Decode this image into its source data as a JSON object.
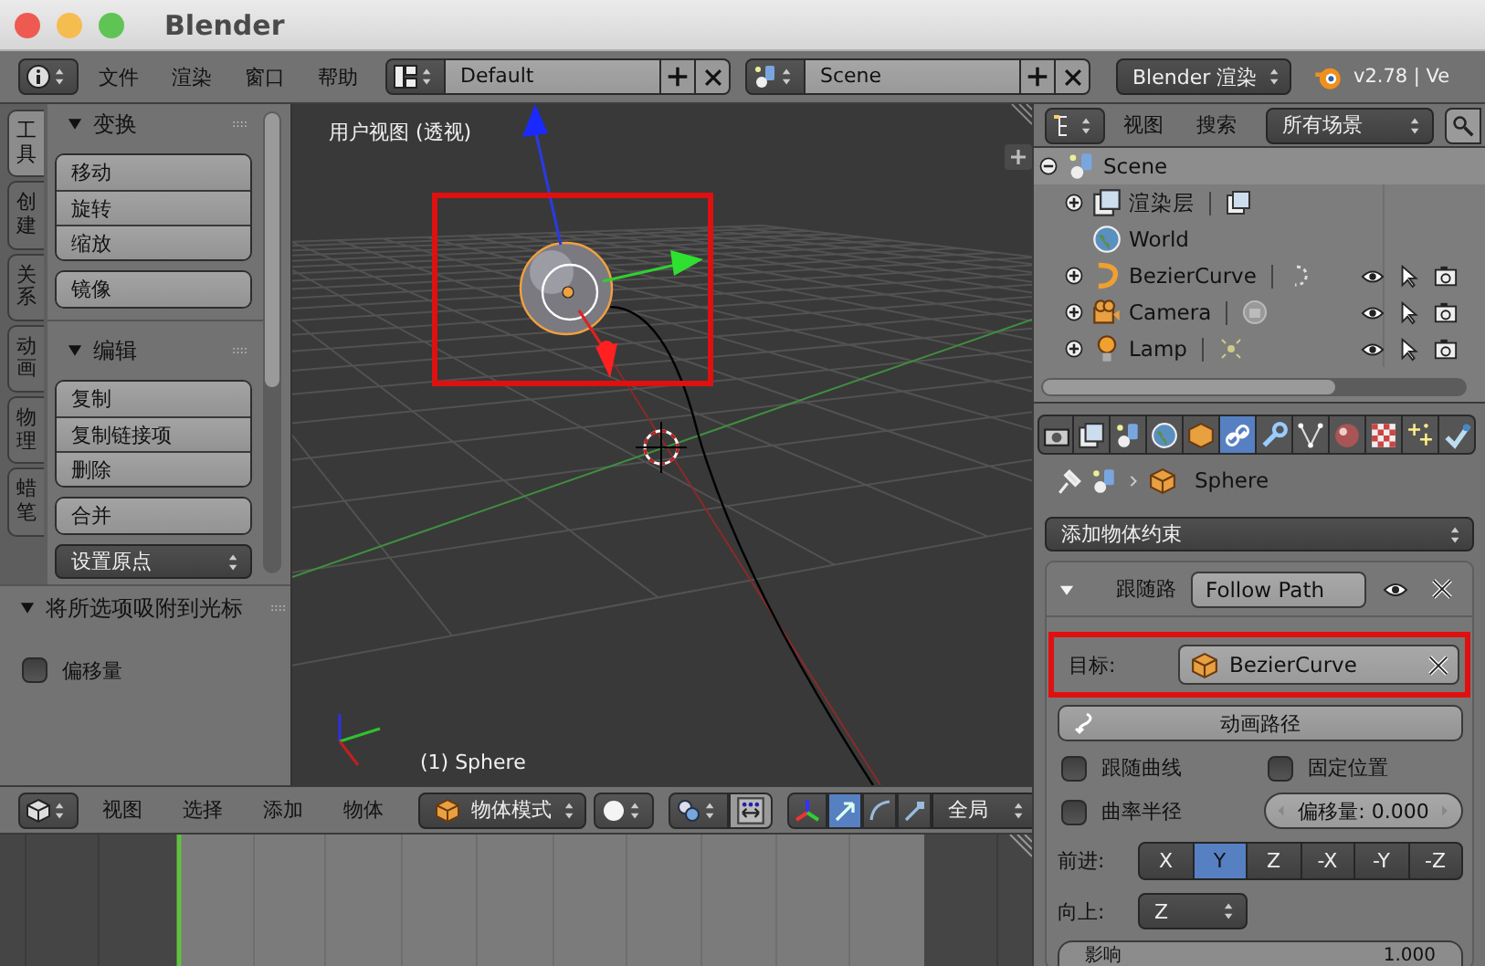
{
  "window": {
    "title": "Blender"
  },
  "info_header": {
    "menus": [
      "文件",
      "渲染",
      "窗口",
      "帮助"
    ],
    "layout": "Default",
    "scene": "Scene",
    "render_engine": "Blender 渲染",
    "version": "v2.78 | Ve"
  },
  "tool_tabs": [
    {
      "label": "工具",
      "selected": true
    },
    {
      "label": "创建",
      "selected": false
    },
    {
      "label": "关系",
      "selected": false
    },
    {
      "label": "动画",
      "selected": false
    },
    {
      "label": "物理",
      "selected": false
    },
    {
      "label": "蜡笔",
      "selected": false
    }
  ],
  "tool_panels": [
    {
      "title": "变换",
      "expanded": true,
      "groups": [
        [
          "移动",
          "旋转",
          "缩放"
        ],
        [
          "镜像"
        ]
      ]
    },
    {
      "title": "编辑",
      "expanded": true,
      "groups": [
        [
          "复制",
          "复制链接项",
          "删除"
        ],
        [
          "合并"
        ]
      ],
      "dropdown": "设置原点"
    }
  ],
  "operator_panel": {
    "title": "将所选项吸附到光标",
    "expanded": true,
    "options": [
      {
        "label": "偏移量",
        "checked": false
      }
    ]
  },
  "viewport": {
    "title": "用户视图 (透视)",
    "object_label": "(1) Sphere"
  },
  "viewport_header": {
    "menus": [
      "视图",
      "选择",
      "添加",
      "物体"
    ],
    "mode": "物体模式",
    "orientation": "全局",
    "manipulator_modes": [
      {
        "kind": "translate",
        "selected": true
      },
      {
        "kind": "rotate",
        "selected": false
      },
      {
        "kind": "scale",
        "selected": false
      }
    ]
  },
  "outliner": {
    "menus": [
      "视图",
      "搜索"
    ],
    "display": "所有场景",
    "tree": [
      {
        "label": "Scene",
        "kind": "scene",
        "expanded": true,
        "children": [
          {
            "label": "渲染层",
            "kind": "render_layers",
            "expanded": false
          },
          {
            "label": "World",
            "kind": "world"
          },
          {
            "label": "BezierCurve",
            "kind": "curve",
            "expanded": false
          },
          {
            "label": "Camera",
            "kind": "camera",
            "expanded": false
          },
          {
            "label": "Lamp",
            "kind": "lamp",
            "expanded": false
          }
        ]
      }
    ]
  },
  "properties_tabs": [
    {
      "kind": "render",
      "selected": false
    },
    {
      "kind": "render_layers",
      "selected": false
    },
    {
      "kind": "scene",
      "selected": false
    },
    {
      "kind": "world",
      "selected": false
    },
    {
      "kind": "object",
      "selected": false
    },
    {
      "kind": "constraints",
      "selected": true
    },
    {
      "kind": "modifiers",
      "selected": false
    },
    {
      "kind": "data",
      "selected": false
    },
    {
      "kind": "material",
      "selected": false
    },
    {
      "kind": "texture",
      "selected": false
    },
    {
      "kind": "particles",
      "selected": false
    },
    {
      "kind": "physics",
      "selected": false
    }
  ],
  "properties": {
    "breadcrumb": "Sphere",
    "add_constraint": "添加物体约束",
    "constraint": {
      "type_label": "跟随路",
      "name": "Follow Path",
      "expanded": true,
      "target_label": "目标:",
      "target": "BezierCurve",
      "animate_button": "动画路径",
      "options": [
        {
          "label": "跟随曲线",
          "checked": false
        },
        {
          "label": "固定位置",
          "checked": false
        },
        {
          "label": "曲率半径",
          "checked": false
        }
      ],
      "offset": "偏移量: 0.000",
      "forward_label": "前进:",
      "forward_axes": [
        {
          "label": "X",
          "selected": false
        },
        {
          "label": "Y",
          "selected": true
        },
        {
          "label": "Z",
          "selected": false
        },
        {
          "label": "-X",
          "selected": false
        },
        {
          "label": "-Y",
          "selected": false
        },
        {
          "label": "-Z",
          "selected": false
        }
      ],
      "up_label": "向上:",
      "up": "Z",
      "influence_label": "影响",
      "influence": "1.000",
      "level": 1
    }
  }
}
